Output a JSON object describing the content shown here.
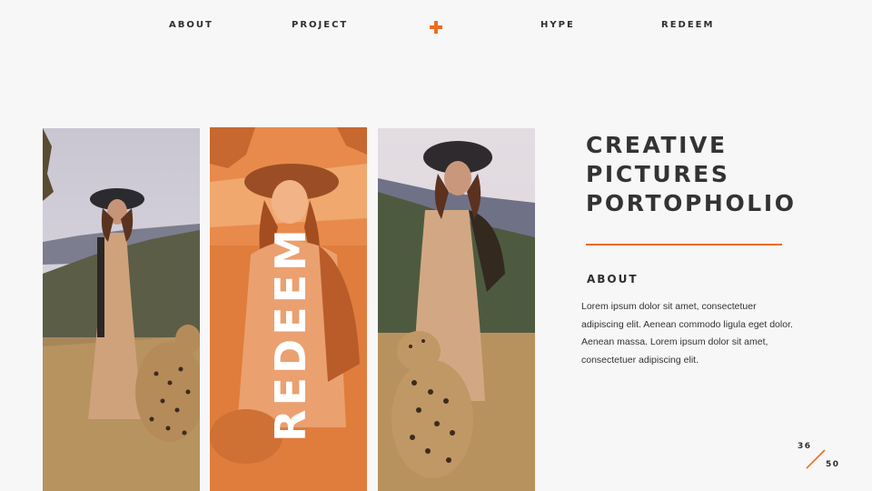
{
  "nav": {
    "items": [
      "ABOUT",
      "PROJECT",
      "HYPE",
      "REDEEM"
    ],
    "center_icon": "plus-icon"
  },
  "gallery": {
    "overlay_word": "REDEEM",
    "overlay_color": "#ef6c1f"
  },
  "headline": {
    "lines": [
      "CREATIVE",
      "PICTURES",
      "PORTOPHOLIO"
    ]
  },
  "about": {
    "heading": "ABOUT",
    "body": "Lorem ipsum dolor sit amet, consectetuer adipiscing elit. Aenean commodo ligula eget dolor. Aenean massa. Lorem ipsum dolor sit amet, consectetuer adipiscing elit."
  },
  "pagination": {
    "current": "36",
    "total": "50"
  },
  "colors": {
    "accent": "#ef6c1f",
    "background": "#f7f7f7",
    "text": "#2e2e2e"
  }
}
